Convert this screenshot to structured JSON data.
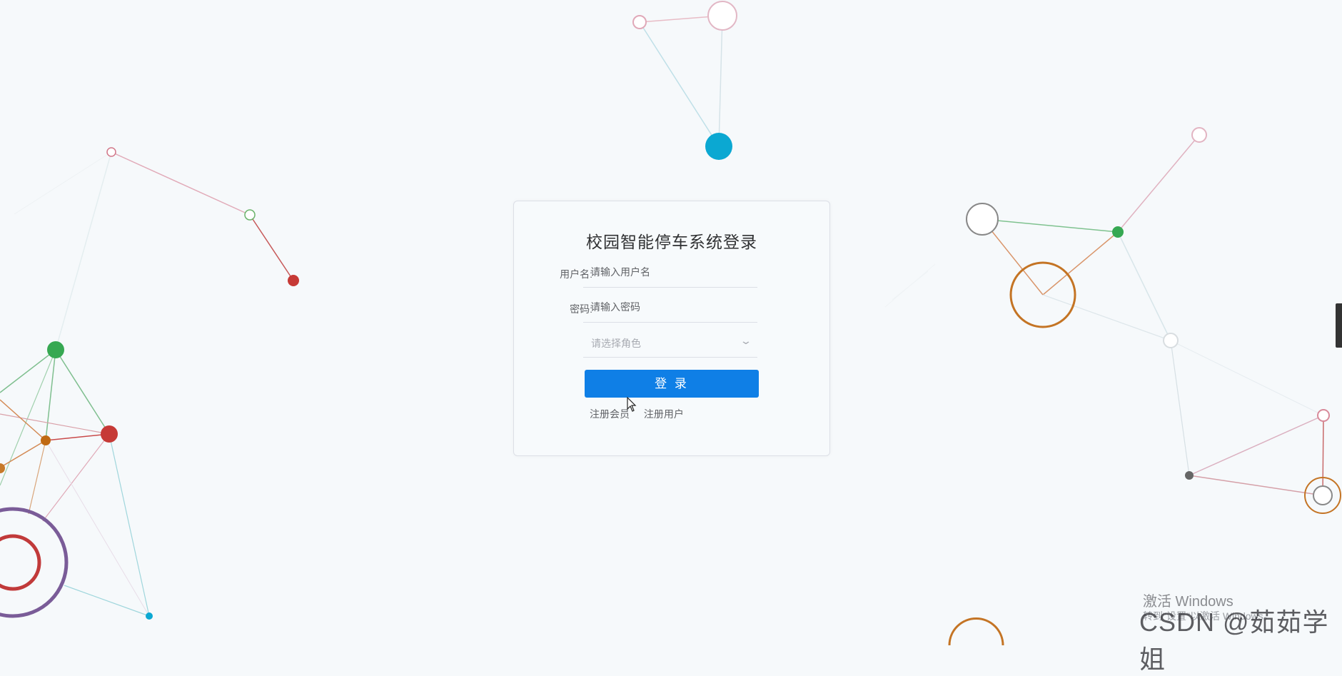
{
  "login": {
    "title": "校园智能停车系统登录",
    "username_label": "用户名:",
    "username_placeholder": "请输入用户名",
    "password_label": "密码:",
    "password_placeholder": "请输入密码",
    "role_placeholder": "请选择角色",
    "login_button": "登 录",
    "link_register_member": "注册会员",
    "link_register_user": "注册用户"
  },
  "overlay": {
    "activate_windows": "激活 Windows",
    "activate_hint": "转到\"设置\"以激活 Windows。",
    "watermark": "CSDN @茹茹学姐"
  },
  "colors": {
    "primary_button": "#0f7fe6",
    "background": "#f6f9fb"
  }
}
